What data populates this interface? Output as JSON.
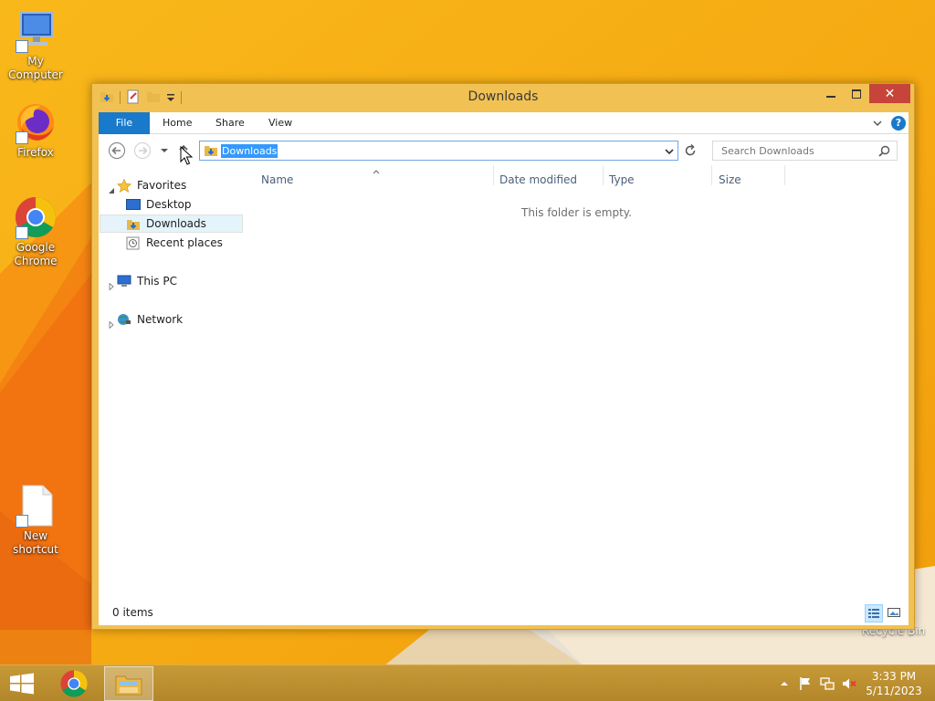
{
  "desktop": {
    "icons": [
      {
        "label": "My Computer"
      },
      {
        "label": "Firefox"
      },
      {
        "label": "Google Chrome"
      },
      {
        "label": "New shortcut"
      }
    ],
    "recycle_bin_label": "Recycle Bin"
  },
  "window": {
    "title": "Downloads",
    "close_glyph": "✕",
    "ribbon": {
      "tabs": [
        "File",
        "Home",
        "Share",
        "View"
      ],
      "help_glyph": "?"
    },
    "address": {
      "value": "Downloads"
    },
    "search": {
      "placeholder": "Search Downloads"
    },
    "nav_pane": {
      "favorites_label": "Favorites",
      "favorites": [
        "Desktop",
        "Downloads",
        "Recent places"
      ],
      "selected": "Downloads",
      "this_pc_label": "This PC",
      "network_label": "Network"
    },
    "columns": [
      "Name",
      "Date modified",
      "Type",
      "Size"
    ],
    "empty_message": "This folder is empty.",
    "status": {
      "item_count": "0 items"
    }
  },
  "taskbar": {
    "time": "3:33 PM",
    "date": "5/11/2023"
  },
  "colors": {
    "wallpaper": "#f7ab14",
    "window_frame": "#f1c153",
    "file_tab": "#1979ca",
    "selection": "#3399ff",
    "close_button": "#c7443a"
  }
}
